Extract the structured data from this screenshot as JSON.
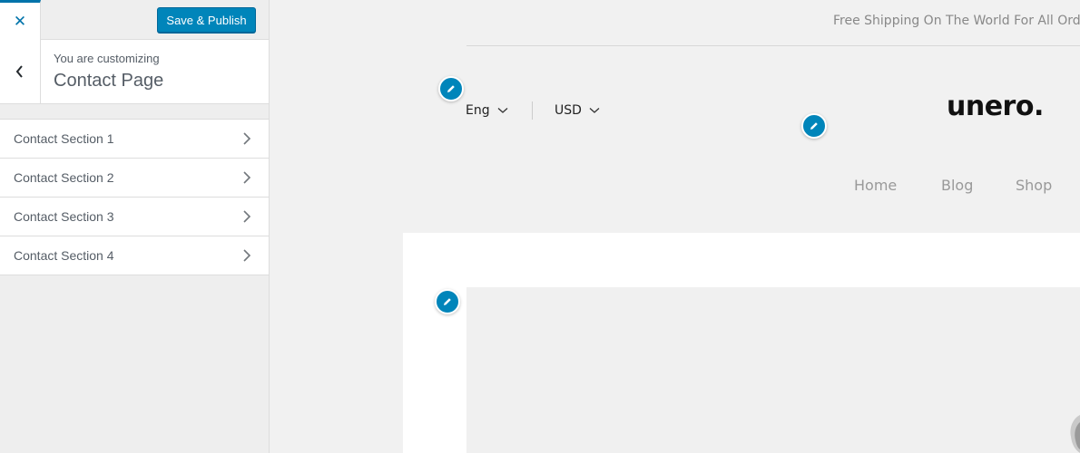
{
  "sidebar": {
    "close_icon": "close-icon",
    "publish_label": "Save & Publish",
    "customizing_label": "You are customizing",
    "page_name": "Contact Page",
    "back_icon": "chevron-left-icon",
    "sections": [
      {
        "label": "Contact Section 1"
      },
      {
        "label": "Contact Section 2"
      },
      {
        "label": "Contact Section 3"
      },
      {
        "label": "Contact Section 4"
      }
    ]
  },
  "preview": {
    "shipping_text": "Free Shipping On The World For All Orde",
    "language": "Eng",
    "currency": "USD",
    "logo": "unero.",
    "nav": [
      "Home",
      "Blog",
      "Shop"
    ],
    "edit_icon": "pencil-icon"
  },
  "colors": {
    "accent": "#0085ba",
    "accent_dark": "#0073aa",
    "sidebar_bg": "#eeeeee",
    "preview_bg": "#f1f1f1",
    "text": "#555d66"
  }
}
